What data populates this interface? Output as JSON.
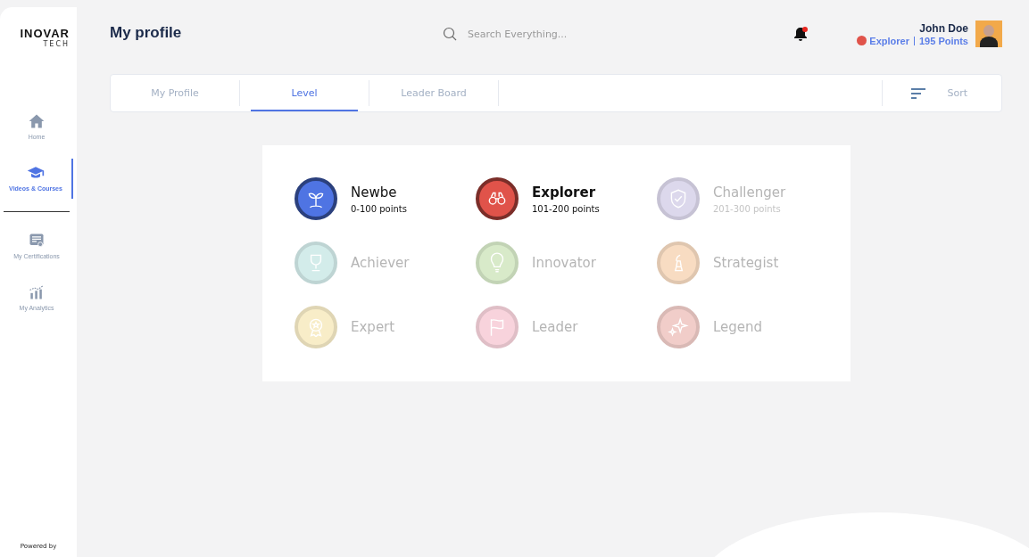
{
  "logo": {
    "name": "INOVAR",
    "sub": "TECH"
  },
  "sidebar": {
    "items": [
      {
        "label": "Home",
        "selected": false
      },
      {
        "label": "Videos & Courses",
        "selected": true
      },
      {
        "label": "My Certifications",
        "selected": false
      },
      {
        "label": "My Analytics",
        "selected": false
      }
    ],
    "footer": "Powered by"
  },
  "header": {
    "title": "My profile",
    "search": {
      "placeholder": "Search Everything..."
    },
    "notification": {
      "unread": true
    },
    "user": {
      "name": "John Doe",
      "level": "Explorer",
      "points": "195 Points"
    }
  },
  "tabs": [
    {
      "label": "My Profile",
      "selected": false
    },
    {
      "label": "Level",
      "selected": true
    },
    {
      "label": "Leader Board",
      "selected": false
    }
  ],
  "sort": {
    "label": "Sort"
  },
  "levels": [
    {
      "name": "Newbe",
      "points": "0-100 points",
      "current": false,
      "locked": false,
      "color": "#4f74e3"
    },
    {
      "name": "Explorer",
      "points": "101-200 points",
      "current": true,
      "locked": false,
      "color": "#e0534a"
    },
    {
      "name": "Challenger",
      "points": "201-300 points",
      "current": false,
      "locked": true,
      "color": "#dcd8ec"
    },
    {
      "name": "Achiever",
      "current": false,
      "locked": true,
      "color": "#d3ecea"
    },
    {
      "name": "Innovator",
      "current": false,
      "locked": true,
      "color": "#d8eac9"
    },
    {
      "name": "Strategist",
      "current": false,
      "locked": true,
      "color": "#f8dcc2"
    },
    {
      "name": "Expert",
      "current": false,
      "locked": true,
      "color": "#f8edc8"
    },
    {
      "name": "Leader",
      "current": false,
      "locked": true,
      "color": "#f8d3dc"
    },
    {
      "name": "Legend",
      "current": false,
      "locked": true,
      "color": "#f1cdc9"
    }
  ]
}
